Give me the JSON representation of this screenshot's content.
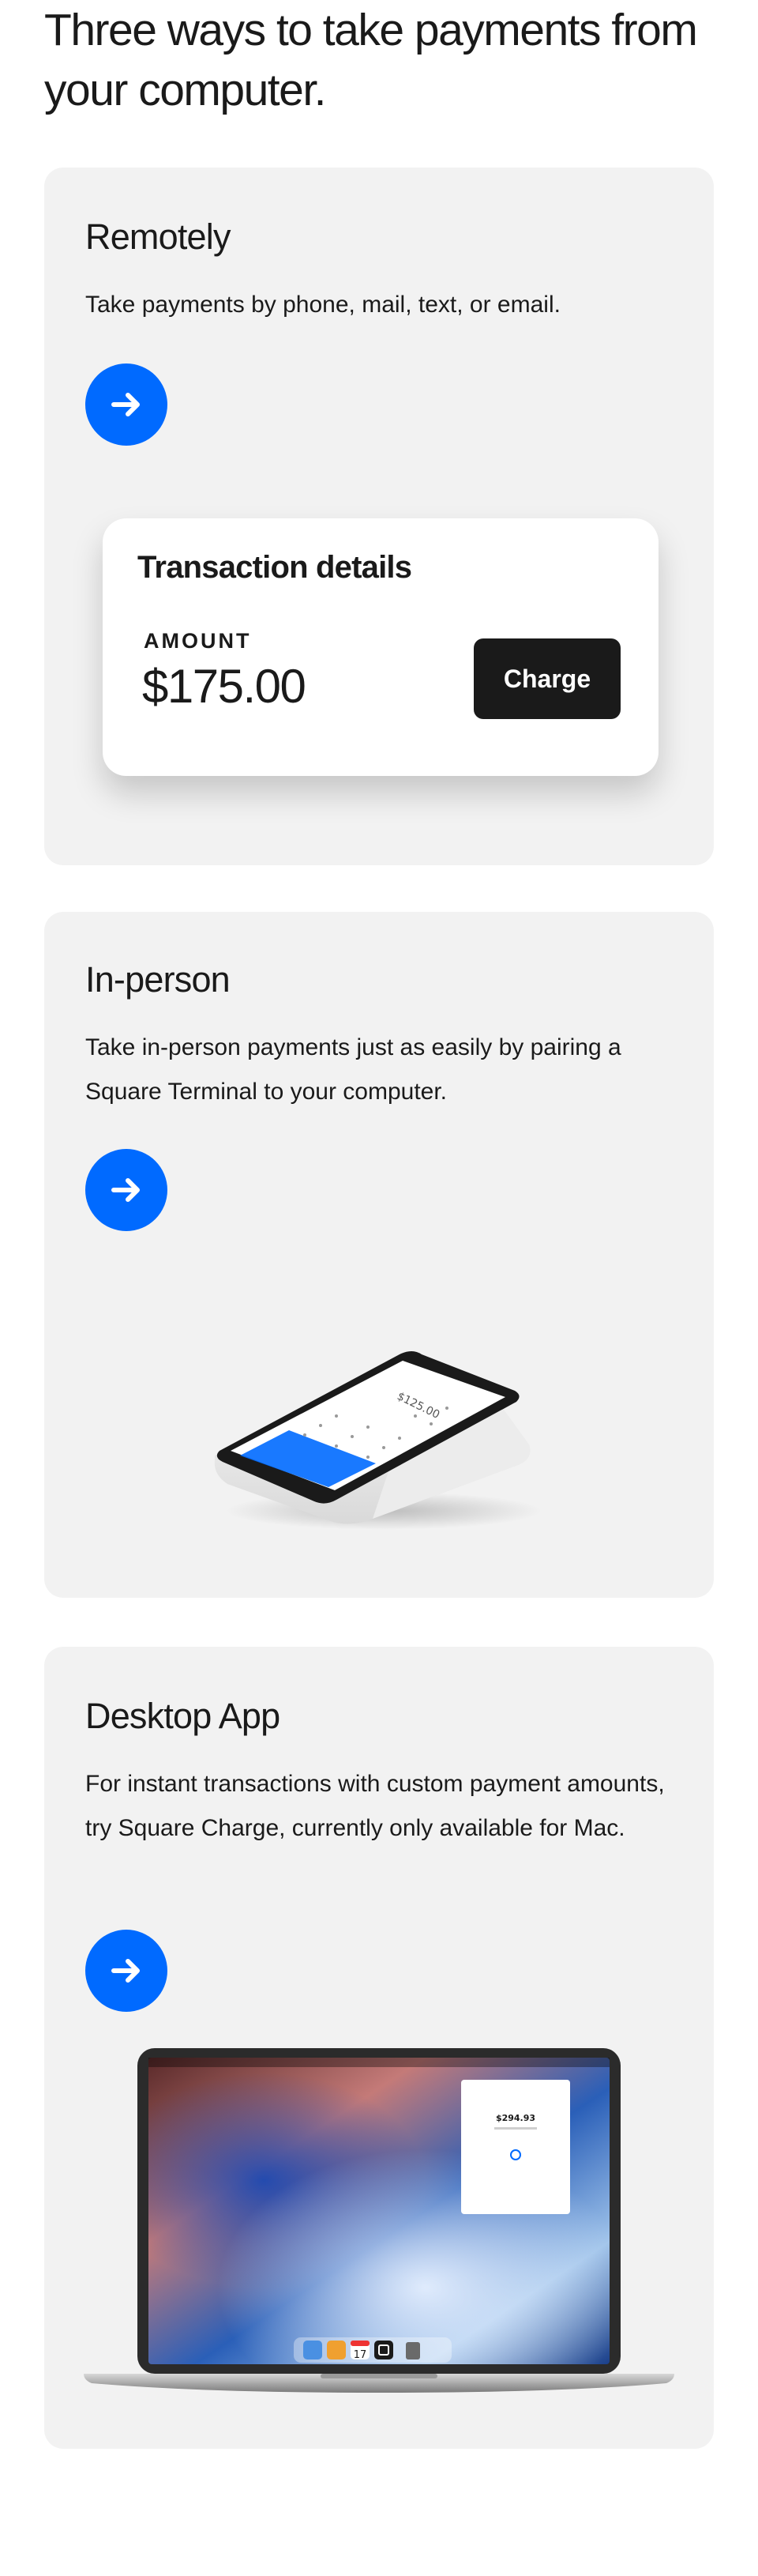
{
  "headline": "Three ways to take payments from your computer.",
  "cards": [
    {
      "title": "Remotely",
      "description": "Take payments by phone, mail, text, or email.",
      "transaction": {
        "title": "Transaction details",
        "amount_label": "AMOUNT",
        "amount": "$175.00",
        "charge_label": "Charge"
      }
    },
    {
      "title": "In-person",
      "description": "Take in-person payments just as easily by pairing a Square Terminal to your computer.",
      "terminal_amount": "$125.00"
    },
    {
      "title": "Desktop App",
      "description": "For instant transactions with custom payment amounts, try Square Charge, currently only available for Mac.",
      "popup_amount": "$294.93",
      "dock_calendar_day": "17"
    }
  ],
  "colors": {
    "accent": "#006aff",
    "card_bg": "#f2f2f2",
    "text": "#1a1a1a"
  },
  "icons": {
    "card_link": "arrow-right-icon"
  }
}
